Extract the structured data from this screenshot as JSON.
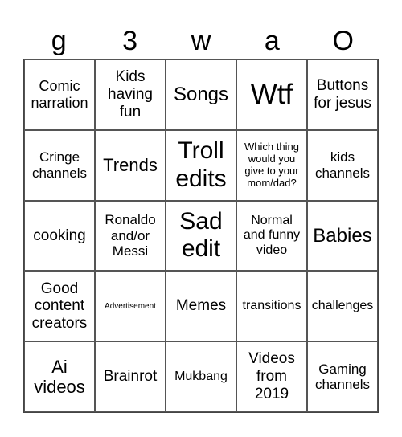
{
  "header": [
    "g",
    "3",
    "w",
    "a",
    "O"
  ],
  "cells": [
    "Comic narration",
    "Kids having fun",
    "Songs",
    "Wtf",
    "Buttons for jesus",
    "Cringe channels",
    "Trends",
    "Troll edits",
    "Which thing would you give to your mom/dad?",
    "kids channels",
    "cooking",
    "Ronaldo and/or Messi",
    "Sad edit",
    "Normal and funny video",
    "Babies",
    "Good content creators",
    "Advertisement",
    "Memes",
    "transitions",
    "challenges",
    "Ai videos",
    "Brainrot",
    "Mukbang",
    "Videos from 2019",
    "Gaming channels"
  ],
  "colors": {
    "grid_line": "#555555",
    "text": "#000000",
    "background": "#ffffff"
  }
}
